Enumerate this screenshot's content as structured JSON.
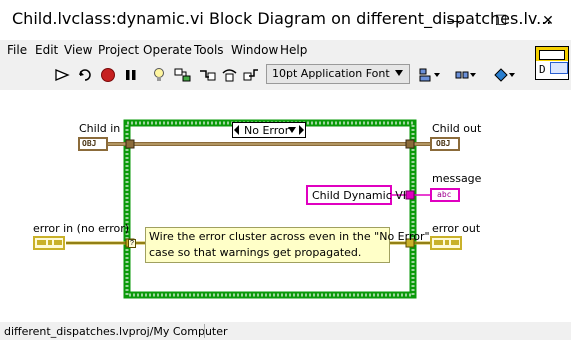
{
  "window": {
    "title": "Child.lvclass:dynamic.vi Block Diagram on different_dispatches.lv...",
    "minimize_glyph": "—",
    "maximize_glyph": "☐",
    "close_glyph": "✕"
  },
  "menu": {
    "items": [
      "File",
      "Edit",
      "View",
      "Project",
      "Operate",
      "Tools",
      "Window",
      "Help"
    ]
  },
  "toolbar": {
    "font_select_value": "10pt Application Font",
    "icon_letter": "D",
    "icons": [
      "run-arrow-icon",
      "run-continuously-icon",
      "abort-icon",
      "pause-icon",
      "highlight-execution-icon",
      "retain-wire-values-icon",
      "step-into-icon",
      "step-over-icon",
      "step-out-icon",
      "align-objects-icon",
      "distribute-objects-icon",
      "reorder-icon",
      "clean-up-diagram-icon"
    ]
  },
  "diagram": {
    "case_selector_value": "No Error",
    "labels": {
      "child_in": "Child in",
      "child_out": "Child out",
      "message": "message",
      "error_in": "error in (no error)",
      "error_out": "error out"
    },
    "terminals": {
      "obj": "OBJ",
      "abc": "abc"
    },
    "string_constant": "Child Dynamic VI",
    "comment_line1": "Wire the error cluster across even in the \"No Error\"",
    "comment_line2": "case so that warnings get propagated.",
    "colors": {
      "case_border": "#0a9a0a",
      "class_wire": "#8b6b3a",
      "error_wire": "#c9b12a",
      "string_wire": "#e000c0",
      "comment_bg": "#ffffc8"
    }
  },
  "status": {
    "path": "different_dispatches.lvproj/My Computer"
  }
}
